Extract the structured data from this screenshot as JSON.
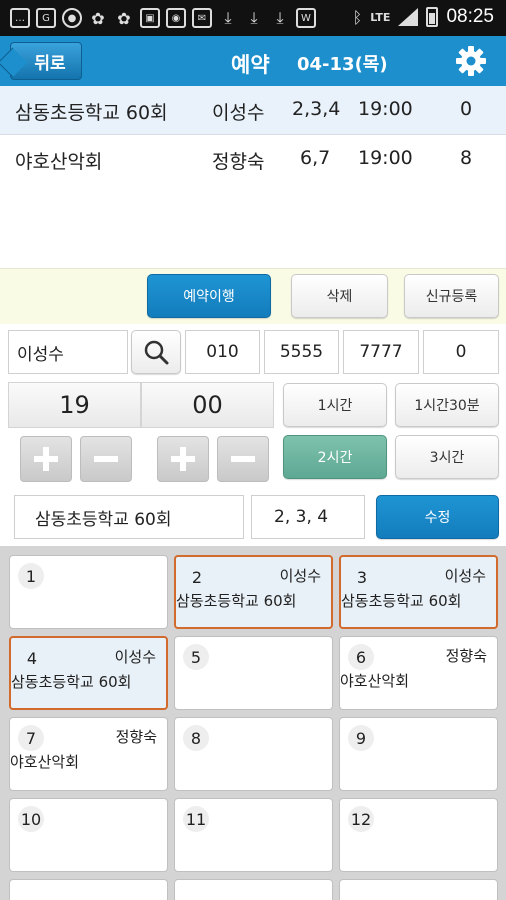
{
  "status_bar": {
    "time": "08:25",
    "network": "LTE",
    "icons": [
      "messenger-icon",
      "chat-icon",
      "person-icon",
      "blossom-icon",
      "blossom-icon",
      "image-icon",
      "camera-icon",
      "mail-icon",
      "download-icon",
      "download-icon",
      "download-icon",
      "app-icon"
    ]
  },
  "header": {
    "back_label": "뒤로",
    "title": "예약",
    "date": "04-13(목)",
    "accent_color": "#1d8fcd"
  },
  "reservations": [
    {
      "group": "삼동초등학교 60회",
      "name": "이성수",
      "tables": "2,3,4",
      "time": "19:00",
      "count": "0",
      "selected": true
    },
    {
      "group": "야호산악회",
      "name": "정향숙",
      "tables": "6,7",
      "time": "19:00",
      "count": "8",
      "selected": false
    }
  ],
  "actions": {
    "execute": "예약이행",
    "delete": "삭제",
    "new": "신규등록"
  },
  "form": {
    "name": "이성수",
    "phone1": "010",
    "phone2": "5555",
    "phone3": "7777",
    "count": "0",
    "hour": "19",
    "minute": "00",
    "group": "삼동초등학교 60회",
    "tables": "2, 3, 4",
    "duration_1h": "1시간",
    "duration_1h30": "1시간30분",
    "duration_2h": "2시간",
    "duration_3h": "3시간",
    "edit": "수정",
    "selected_duration": "2시간"
  },
  "tables": [
    {
      "num": "1",
      "name": "",
      "group": "",
      "booked": false
    },
    {
      "num": "2",
      "name": "이성수",
      "group": "삼동초등학교 60회",
      "booked": true
    },
    {
      "num": "3",
      "name": "이성수",
      "group": "삼동초등학교 60회",
      "booked": true
    },
    {
      "num": "4",
      "name": "이성수",
      "group": "삼동초등학교 60회",
      "booked": true
    },
    {
      "num": "5",
      "name": "",
      "group": "",
      "booked": false
    },
    {
      "num": "6",
      "name": "정향숙",
      "group": "야호산악회",
      "booked": false
    },
    {
      "num": "7",
      "name": "정향숙",
      "group": "야호산악회",
      "booked": false
    },
    {
      "num": "8",
      "name": "",
      "group": "",
      "booked": false
    },
    {
      "num": "9",
      "name": "",
      "group": "",
      "booked": false
    },
    {
      "num": "10",
      "name": "",
      "group": "",
      "booked": false
    },
    {
      "num": "11",
      "name": "",
      "group": "",
      "booked": false
    },
    {
      "num": "12",
      "name": "",
      "group": "",
      "booked": false
    }
  ]
}
